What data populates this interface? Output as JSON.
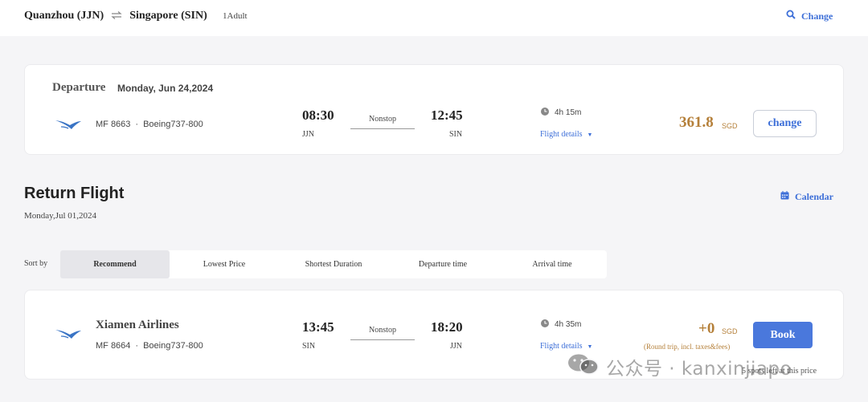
{
  "header": {
    "origin": "Quanzhou (JJN)",
    "destination": "Singapore (SIN)",
    "passengers": "1Adult",
    "change_label": "Change",
    "swap_icon": "swap-arrows-icon",
    "search_icon": "search-icon"
  },
  "departure": {
    "title": "Departure",
    "date": "Monday, Jun 24,2024",
    "flight_number": "MF 8663",
    "aircraft": "Boeing737-800",
    "depart_time": "08:30",
    "depart_code": "JJN",
    "stops": "Nonstop",
    "arrive_time": "12:45",
    "arrive_code": "SIN",
    "duration": "4h 15m",
    "details_label": "Flight details",
    "price": "361.8",
    "currency": "SGD",
    "button_label": "change"
  },
  "return": {
    "title": "Return Flight",
    "date": "Monday,Jul 01,2024",
    "calendar_label": "Calendar",
    "calendar_icon": "calendar-icon"
  },
  "sort": {
    "label": "Sort by",
    "options": [
      "Recommend",
      "Lowest Price",
      "Shortest Duration",
      "Departure time",
      "Arrival time"
    ],
    "selected": "Recommend"
  },
  "return_flight": {
    "airline": "Xiamen Airlines",
    "flight_number": "MF 8664",
    "aircraft": "Boeing737-800",
    "depart_time": "13:45",
    "depart_code": "SIN",
    "stops": "Nonstop",
    "arrive_time": "18:20",
    "arrive_code": "JJN",
    "duration": "4h 35m",
    "details_label": "Flight details",
    "price": "+0",
    "currency": "SGD",
    "price_note": "(Round trip, incl. taxes&fees)",
    "button_label": "Book",
    "spots_left": "5 spots left at this price"
  },
  "watermark": {
    "text": "公众号 · kanxinjiapo",
    "icon": "wechat-icon"
  },
  "colors": {
    "accent": "#3d6fd8",
    "button_primary": "#4a78dc",
    "price": "#b5803a",
    "background": "#f5f5f7"
  }
}
